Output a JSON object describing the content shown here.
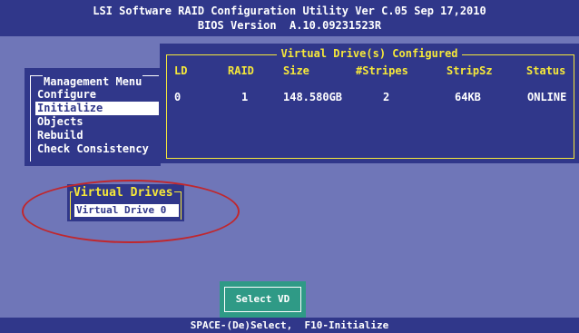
{
  "title": {
    "line1": "LSI Software RAID Configuration Utility Ver C.05 Sep 17,2010",
    "line2": "BIOS Version  A.10.09231523R"
  },
  "management_menu": {
    "title": "Management Menu",
    "items": [
      {
        "label": "Configure"
      },
      {
        "label": "Initialize"
      },
      {
        "label": "Objects"
      },
      {
        "label": "Rebuild"
      },
      {
        "label": "Check Consistency"
      }
    ],
    "selected": "Initialize"
  },
  "virtual_drives_configured": {
    "title": "Virtual Drive(s) Configured",
    "headers": {
      "ld": "LD",
      "raid": "RAID",
      "size": "Size",
      "stripes": "#Stripes",
      "stripsz": "StripSz",
      "status": "Status"
    },
    "rows": [
      {
        "ld": "0",
        "raid": "1",
        "size": "148.580GB",
        "stripes": "2",
        "stripsz": "64KB",
        "status": "ONLINE"
      }
    ]
  },
  "virtual_drives": {
    "title": "Virtual Drives",
    "items": [
      {
        "label": "Virtual Drive 0"
      }
    ]
  },
  "select_button": {
    "label": "Select VD"
  },
  "statusbar": {
    "text": "SPACE-(De)Select,  F10-Initialize"
  },
  "colors": {
    "background": "#6f76b8",
    "panel": "#30378a",
    "accent_yellow": "#f6e83a",
    "button_green": "#2f9a86",
    "highlight_circle": "#c0272d"
  }
}
